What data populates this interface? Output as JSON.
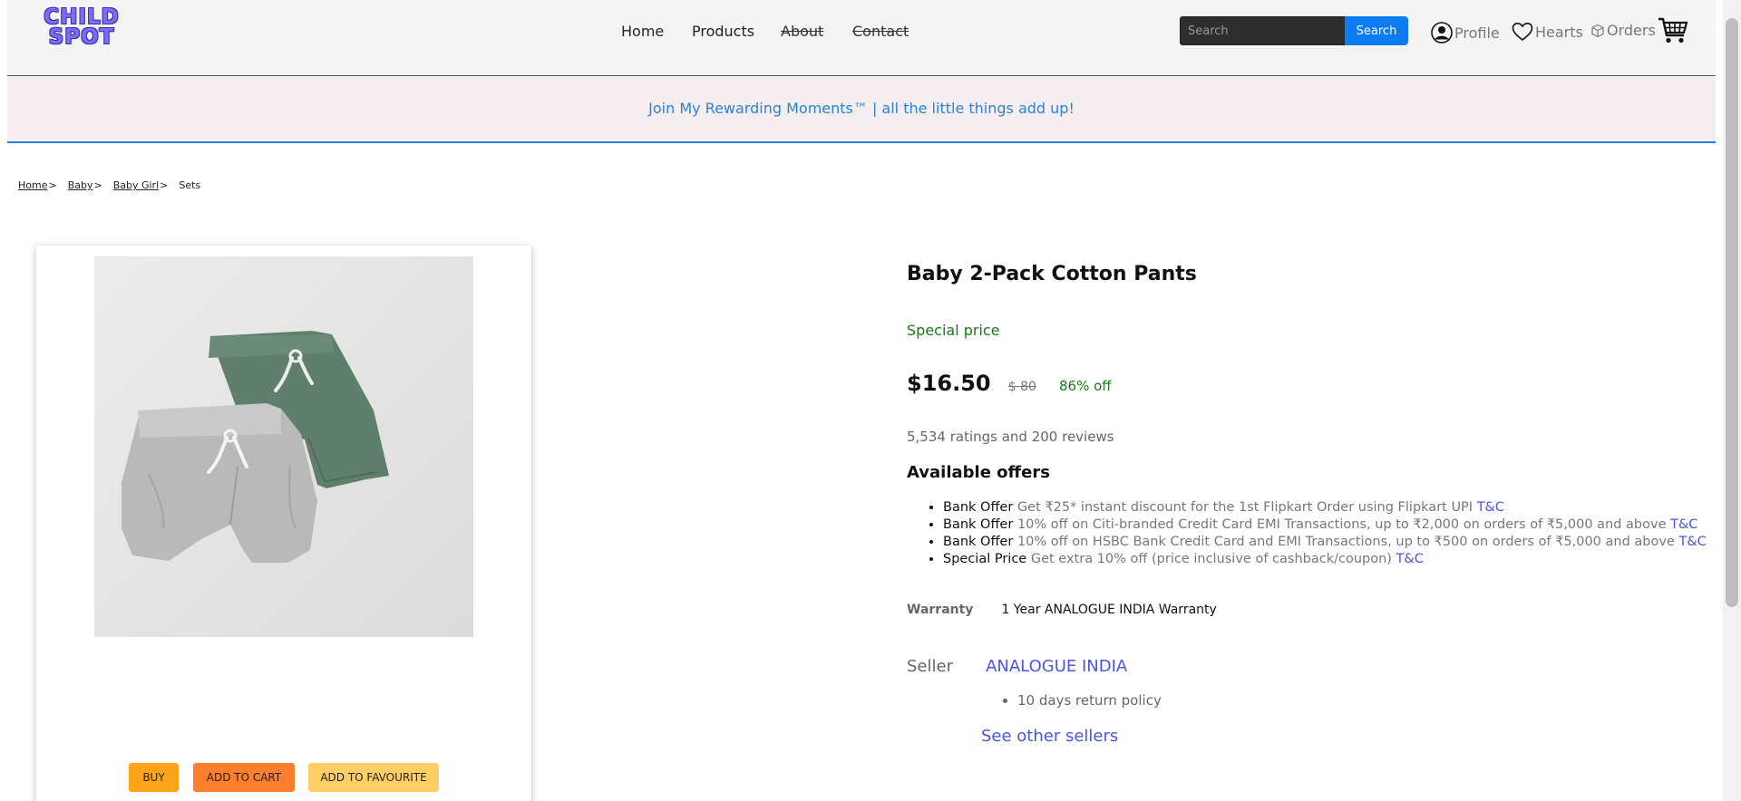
{
  "header": {
    "logo_line1": "CHILD",
    "logo_line2": "SPOT",
    "nav": [
      {
        "label": "Home"
      },
      {
        "label": "Products"
      },
      {
        "label": "About"
      },
      {
        "label": "Contact"
      }
    ],
    "search": {
      "placeholder": "Search",
      "button_label": "Search"
    },
    "links": {
      "profile": "Profile",
      "hearts": "Hearts",
      "orders": "Orders"
    }
  },
  "banner": {
    "text": "Join My Rewarding Moments™ | all the little things add up!"
  },
  "breadcrumb": {
    "home": "Home",
    "baby": "Baby",
    "baby_girl": "Baby Girl",
    "current": "Sets",
    "separator": ">"
  },
  "product": {
    "image_alt": "Baby 2-Pack Cotton Pants",
    "title": "Baby 2-Pack Cotton Pants",
    "special_label": "Special price",
    "price": "$16.50",
    "old_price": "$ 80",
    "discount": "86% off",
    "ratings": "5,534 ratings and 200 reviews",
    "actions": {
      "buy": "BUY",
      "add_to_cart": "ADD TO CART",
      "add_to_favourite": "ADD TO FAVOURITE"
    }
  },
  "offers": {
    "title": "Available offers",
    "items": [
      {
        "kind": "Bank Offer",
        "desc": "Get ₹25* instant discount for the 1st Flipkart Order using Flipkart UPI",
        "tc": "T&C"
      },
      {
        "kind": "Bank Offer",
        "desc": "10% off on Citi-branded Credit Card EMI Transactions, up to ₹2,000 on orders of ₹5,000 and above",
        "tc": "T&C"
      },
      {
        "kind": "Bank Offer",
        "desc": "10% off on HSBC Bank Credit Card and EMI Transactions, up to ₹500 on orders of ₹5,000 and above",
        "tc": "T&C"
      },
      {
        "kind": "Special Price",
        "desc": "Get extra 10% off (price inclusive of cashback/coupon)",
        "tc": "T&C"
      }
    ]
  },
  "warranty": {
    "label": "Warranty",
    "value": "1 Year ANALOGUE INDIA Warranty"
  },
  "seller": {
    "label": "Seller",
    "name": "ANALOGUE INDIA",
    "policy": "10 days return policy",
    "other_sellers": "See other sellers"
  },
  "colors": {
    "accent": "#0d7cf2",
    "brand": "#7b6cf2",
    "link": "#4a56e0",
    "success": "#1a7a1a",
    "buy": "#ffa31a",
    "cart": "#ff7f2e",
    "favourite": "#ffcf66"
  }
}
